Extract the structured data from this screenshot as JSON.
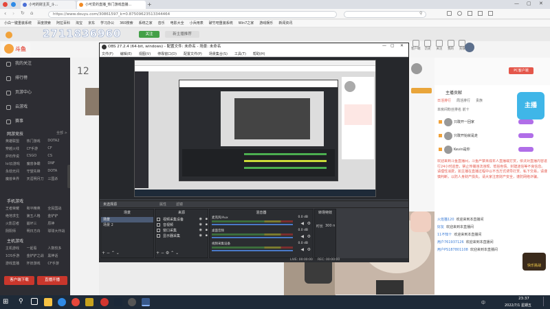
{
  "browser": {
    "tabs": [
      {
        "label": "小可的财主页_斗...",
        "color": "#4a6fd6"
      },
      {
        "label": "小可爱的直播_热门游戏直播...",
        "color": "#f08a24"
      }
    ],
    "url": "https://www.douyu.com/30861597_k=0.87509623513344464",
    "bookmarks": [
      "小白一键重装系统",
      "百度搜索",
      "阿拉百科",
      "淘宝",
      "京东",
      "学习办公",
      "360搜索",
      "系统之家",
      "音乐",
      "电影大全",
      "小兵用表",
      "破竹吧重装系统",
      "Win7之家",
      "游戏娱乐",
      "新闻资讯"
    ]
  },
  "douyu": {
    "logo_text": "斗鱼",
    "room_number": "2711836960",
    "follow_label": "关注",
    "room_tag": "新主播推荐",
    "header_icons": [
      "客户端",
      "历史",
      "关注",
      "我的",
      "充值"
    ],
    "sidebar": {
      "top": [
        "我的关注",
        "排行榜",
        "页游中心",
        "云游戏",
        "赛事"
      ],
      "section_label": "网游竞技",
      "section_extra": "全部 >",
      "grid": [
        [
          "英雄联盟",
          "热门游戏",
          "DOTA2"
        ],
        [
          "穿越火线",
          "CF手游",
          "CF"
        ],
        [
          "炉石传说",
          "CSGO",
          "CS"
        ],
        [
          "lol云游戏",
          "魔兽争霸",
          "DNF"
        ],
        [
          "永劫无间",
          "守望先锋",
          "DOTA"
        ],
        [
          "魔兽世界",
          "天涯明月刀",
          "三国杀"
        ]
      ],
      "section2_label": "手机游戏",
      "grid2": [
        [
          "王者荣耀",
          "和平精英",
          "全民国战"
        ],
        [
          "绝地求生",
          "第五人格",
          "金铲铲"
        ],
        [
          "火影忍者",
          "崩坏三",
          "原神"
        ],
        [
          "阴阳师",
          "明日方舟",
          "球球大作战"
        ]
      ],
      "section3_label": "主机游戏",
      "grid3": [
        [
          "主机游戏",
          "一起看",
          "人数较多"
        ],
        [
          "1OS手游",
          "金铲铲之战",
          "黑神话"
        ],
        [
          "游戏直播",
          "怀旧游戏",
          "CF手游"
        ]
      ],
      "bottom_buttons": [
        "客户端下载",
        "直播开播"
      ]
    },
    "chat": {
      "rank_label": "主播贡献",
      "rank_tabs": [
        "日活排行",
        "周活排行",
        "贵族"
      ],
      "fan_label": "本房间粉丝排名 前十",
      "badge": "主播",
      "pc_client": "PC客户端",
      "users": [
        "只敢开一回家",
        "只敢开始就是走",
        "Kevin是你"
      ],
      "notice": "欢迎来到斗鱼直播间，斗鱼严禁未成年人直播或打赏，依法对直播内容进行24小时巡查，禁止传播违法违规、低俗色情、封建迷信等不良信息。请理性消费，如主播在直播过程中以不当方式诱导打赏、私下交易，请谨慎判断，以防人身财产损失。请大家注意财产安全，谨防网络诈骗。",
      "messages": [
        "欢迎来到本直播间",
        "欢迎来到本直播间",
        "欢迎来到本直播间",
        "欢迎来到本直播间",
        "欢迎来到本直播间"
      ],
      "msg_users": [
        "火焰猫120",
        "好友",
        "11不知十",
        "用户761937126",
        "用户PS187801108"
      ]
    },
    "live_badge": "快乐挑战"
  },
  "obs": {
    "title": "OBS 27.2.4 (64-bit, windows) - 配置文件: 未命名 - 场景: 未命名",
    "menu": [
      "文件(F)",
      "编辑(E)",
      "视图(V)",
      "停靠窗口(D)",
      "配置文件(P)",
      "场景集合(S)",
      "工具(T)",
      "帮助(H)"
    ],
    "source_bar": [
      "未选择源",
      "属性",
      "滤镜"
    ],
    "panels": {
      "scenes": {
        "title": "场景",
        "items": [
          "场景",
          "场景 2"
        ]
      },
      "sources": {
        "title": "来源",
        "items": [
          "视频采集设备",
          "音视频",
          "窗口采集",
          "显示器采集"
        ]
      },
      "mixer": {
        "title": "混音器",
        "tracks": [
          {
            "name": "麦克风/Aux",
            "db": "0.0 dB"
          },
          {
            "name": "桌面音频",
            "db": "0.0 dB"
          },
          {
            "name": "视频采集设备",
            "db": "0.0 dB"
          }
        ]
      },
      "transitions": {
        "title": "转场特效",
        "duration_label": "时长",
        "duration": "300 ms"
      },
      "controls": {
        "title": "控制"
      }
    },
    "status": {
      "live": "LIVE: 00:00:00",
      "rec": "REC: 00:00:00"
    }
  },
  "taskbar": {
    "time": "23:37",
    "date": "2022/7/1 星期五",
    "lang": "中"
  }
}
